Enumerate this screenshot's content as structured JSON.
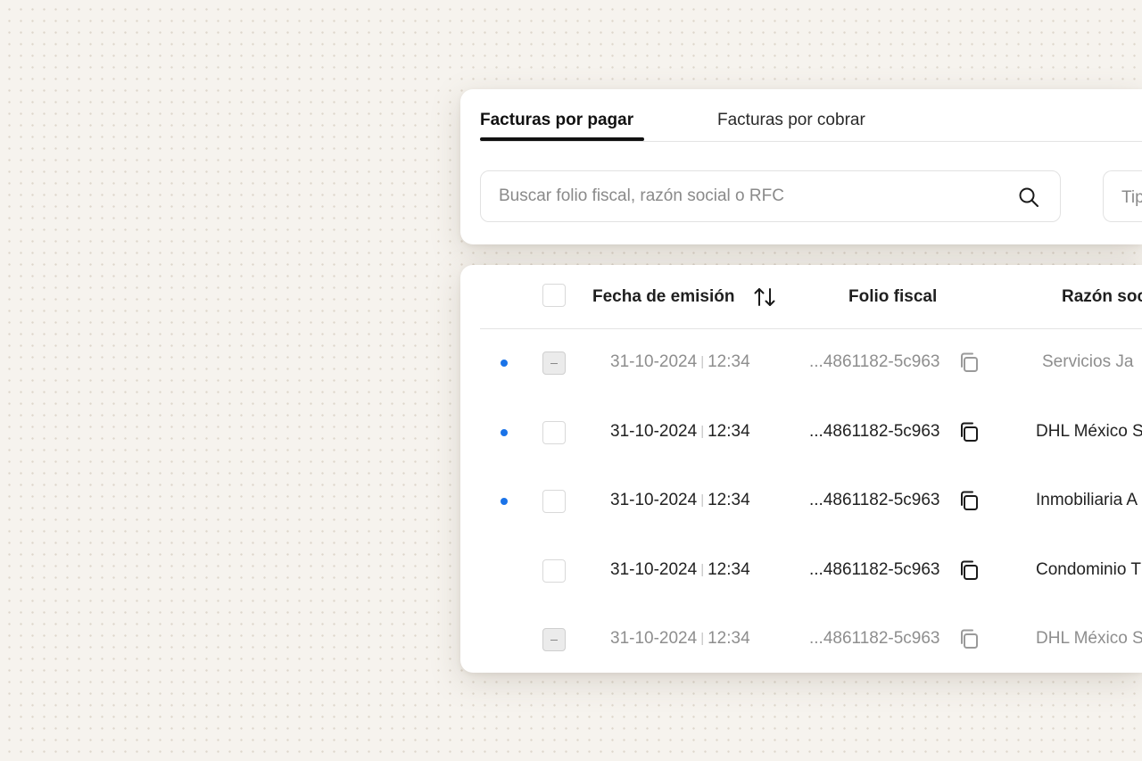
{
  "tabs": [
    {
      "label": "Facturas por pagar",
      "active": true
    },
    {
      "label": "Facturas por cobrar",
      "active": false
    }
  ],
  "search": {
    "placeholder": "Buscar folio fiscal, razón social o RFC"
  },
  "type_filter": {
    "placeholder": "Tip"
  },
  "table": {
    "columns": {
      "date": "Fecha de emisión",
      "folio": "Folio fiscal",
      "company": "Razón soc"
    },
    "rows": [
      {
        "date": "31-10-2024",
        "time": "12:34",
        "folio": "...4861182-5c963",
        "company": "Servicios Ja",
        "unread": true,
        "checkbox": "indeterminate",
        "muted": true
      },
      {
        "date": "31-10-2024",
        "time": "12:34",
        "folio": "...4861182-5c963",
        "company": "DHL México S",
        "unread": true,
        "checkbox": "unchecked",
        "muted": false
      },
      {
        "date": "31-10-2024",
        "time": "12:34",
        "folio": "...4861182-5c963",
        "company": "Inmobiliaria A",
        "unread": true,
        "checkbox": "unchecked",
        "muted": false
      },
      {
        "date": "31-10-2024",
        "time": "12:34",
        "folio": "...4861182-5c963",
        "company": "Condominio T",
        "unread": false,
        "checkbox": "unchecked",
        "muted": false
      },
      {
        "date": "31-10-2024",
        "time": "12:34",
        "folio": "...4861182-5c963",
        "company": "DHL México S",
        "unread": false,
        "checkbox": "indeterminate",
        "muted": true
      }
    ]
  },
  "colors": {
    "accent": "#1a73e8",
    "background": "#f6f3ee"
  },
  "icons": {
    "search": "search-icon",
    "sort": "sort-icon",
    "copy": "copy-icon"
  }
}
